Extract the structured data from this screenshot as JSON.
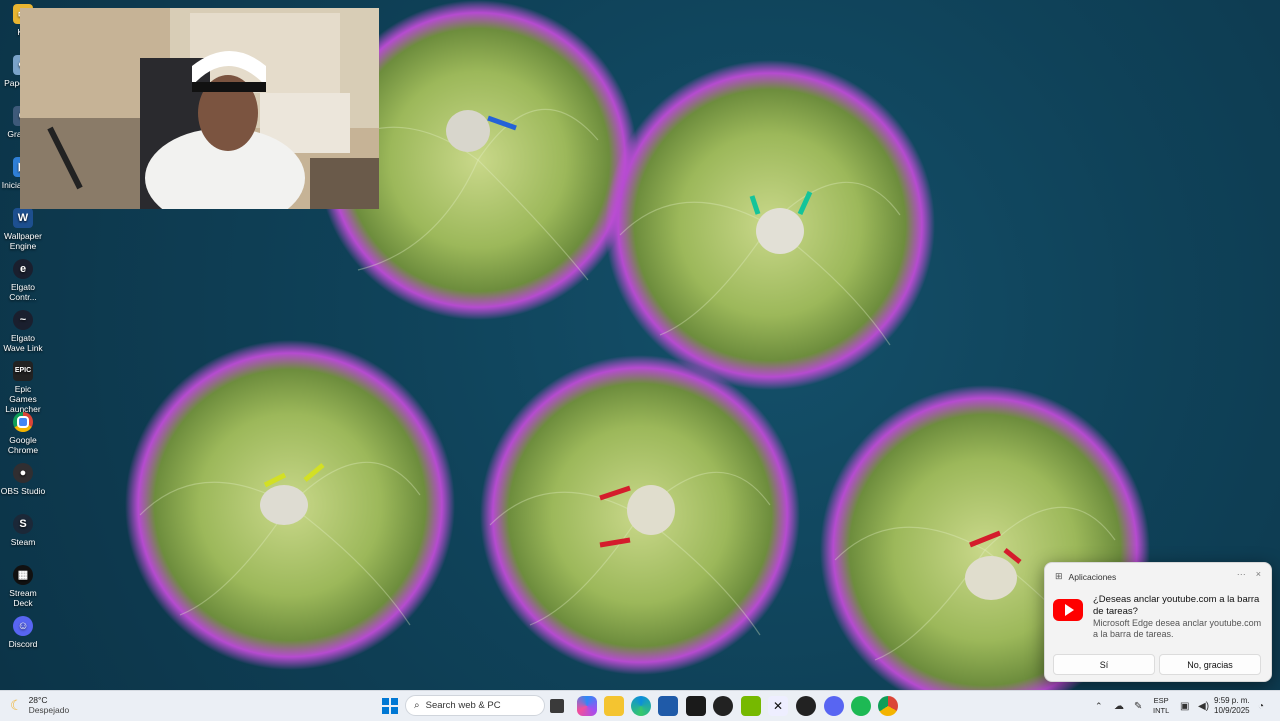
{
  "desktop_icons": [
    {
      "name": "kap",
      "label": "KA"
    },
    {
      "name": "recycle-bin",
      "label": "Papel reci"
    },
    {
      "name": "grand",
      "label": "Gran Au"
    },
    {
      "name": "iniciar",
      "label": "Iniciar en S"
    },
    {
      "name": "wallpaper-engine",
      "label": "Wallpaper Engine"
    },
    {
      "name": "elgato-control",
      "label": "Elgato Contr..."
    },
    {
      "name": "elgato-wave",
      "label": "Elgato Wave Link"
    },
    {
      "name": "epic-games",
      "label": "Epic Games Launcher"
    },
    {
      "name": "google-chrome",
      "label": "Google Chrome"
    },
    {
      "name": "obs-studio",
      "label": "OBS Studio"
    },
    {
      "name": "steam",
      "label": "Steam"
    },
    {
      "name": "stream-deck",
      "label": "Stream Deck"
    },
    {
      "name": "discord",
      "label": "Discord"
    }
  ],
  "notification": {
    "app_name": "Aplicaciones",
    "more_label": "···",
    "close_label": "×",
    "question": "¿Deseas anclar youtube.com a la barra de tareas?",
    "detail": "Microsoft Edge desea anclar youtube.com a la barra de tareas.",
    "yes_label": "Sí",
    "no_label": "No, gracias"
  },
  "taskbar": {
    "weather_temp": "28°C",
    "weather_desc": "Despejado",
    "search_placeholder": "Search web & PC",
    "language": "ESP",
    "layout": "INTL",
    "time": "9:59 p. m.",
    "date": "10/9/2025",
    "apps": [
      "task-view",
      "copilot",
      "file-explorer",
      "edge",
      "store",
      "terminal",
      "elgato",
      "nvidia",
      "capcut",
      "app-red",
      "discord",
      "spotify",
      "chrome"
    ]
  },
  "colors": {
    "accent": "#0067c0",
    "youtube": "#ff0000",
    "water": "#0f4259"
  }
}
